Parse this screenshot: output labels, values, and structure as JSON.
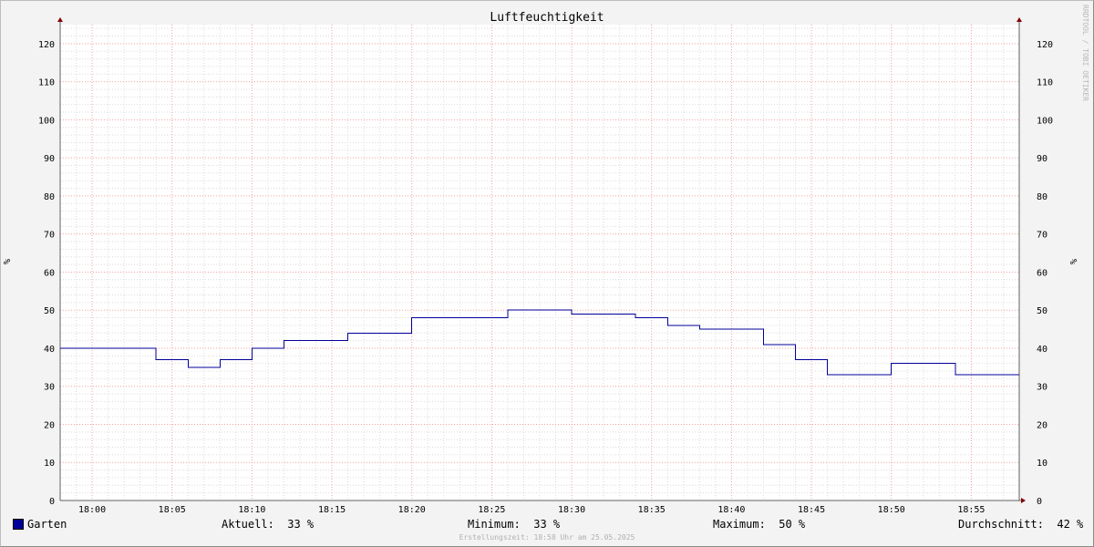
{
  "chart_data": {
    "type": "line",
    "title": "Luftfeuchtigkeit",
    "ylabel": "%",
    "ylabel_right": "%",
    "ylim": [
      0,
      125
    ],
    "yticks": [
      0,
      10,
      20,
      30,
      40,
      50,
      60,
      70,
      80,
      90,
      100,
      110,
      120
    ],
    "xlim": [
      "17:58",
      "18:58"
    ],
    "xticks": [
      "18:00",
      "18:05",
      "18:10",
      "18:15",
      "18:20",
      "18:25",
      "18:30",
      "18:35",
      "18:40",
      "18:45",
      "18:50",
      "18:55"
    ],
    "grid": true,
    "step": true,
    "series": [
      {
        "name": "Garten",
        "color": "#000099",
        "points": [
          {
            "x": "17:58",
            "y": 40
          },
          {
            "x": "18:00",
            "y": 40
          },
          {
            "x": "18:04",
            "y": 37
          },
          {
            "x": "18:06",
            "y": 35
          },
          {
            "x": "18:08",
            "y": 37
          },
          {
            "x": "18:10",
            "y": 40
          },
          {
            "x": "18:12",
            "y": 42
          },
          {
            "x": "18:16",
            "y": 44
          },
          {
            "x": "18:20",
            "y": 48
          },
          {
            "x": "18:26",
            "y": 50
          },
          {
            "x": "18:30",
            "y": 49
          },
          {
            "x": "18:34",
            "y": 48
          },
          {
            "x": "18:36",
            "y": 46
          },
          {
            "x": "18:38",
            "y": 45
          },
          {
            "x": "18:42",
            "y": 41
          },
          {
            "x": "18:44",
            "y": 37
          },
          {
            "x": "18:46",
            "y": 33
          },
          {
            "x": "18:50",
            "y": 36
          },
          {
            "x": "18:54",
            "y": 33
          },
          {
            "x": "18:58",
            "y": 33
          }
        ]
      }
    ],
    "legend": {
      "series_name": "Garten",
      "current_label": "Aktuell:",
      "current_value": "33 %",
      "min_label": "Minimum:",
      "min_value": "33 %",
      "max_label": "Maximum:",
      "max_value": "50 %",
      "avg_label": "Durchschnitt:",
      "avg_value": "42 %"
    }
  },
  "watermark": "RRDTOOL / TOBI OETIKER",
  "footer": "Erstellungszeit: 18:58 Uhr am 25.05.2025",
  "colors": {
    "background": "#f3f3f3",
    "canvas": "#ffffff",
    "minor_grid": "#dcdcdc",
    "major_grid": "#f2a0a0",
    "line": "#000099",
    "arrow": "#800000"
  }
}
